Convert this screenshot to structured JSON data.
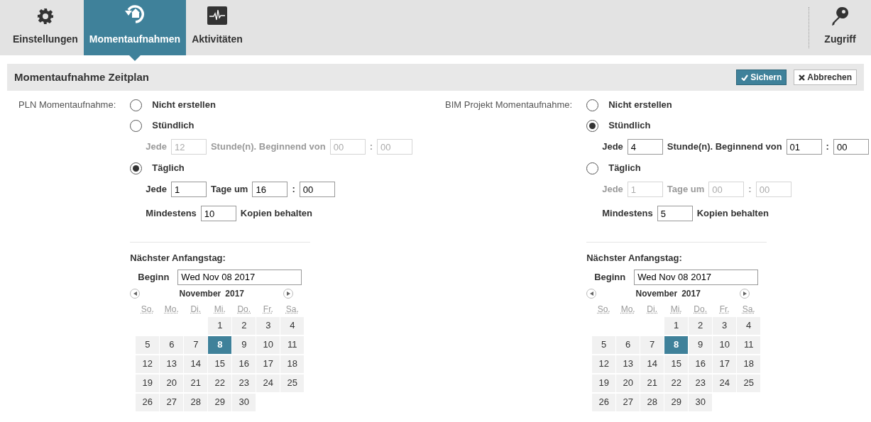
{
  "nav": {
    "tabs": [
      {
        "label": "Einstellungen",
        "selected": false
      },
      {
        "label": "Momentaufnahmen",
        "selected": true
      },
      {
        "label": "Aktivitäten",
        "selected": false
      }
    ],
    "right_tab": {
      "label": "Zugriff",
      "selected": false
    }
  },
  "section": {
    "title": "Momentaufnahme Zeitplan",
    "buttons": [
      {
        "label": "Sichern",
        "kind": "primary"
      },
      {
        "label": "Abbrechen",
        "kind": "secondary"
      }
    ]
  },
  "panels": [
    {
      "label": "PLN Momentaufnahme:",
      "options": [
        {
          "label": "Nicht erstellen",
          "selected": false
        },
        {
          "label": "Stündlich",
          "selected": false,
          "row": {
            "disabled": true,
            "parts": [
              {
                "kind": "text",
                "text": "Jede"
              },
              {
                "kind": "input",
                "value": "12"
              },
              {
                "kind": "text",
                "text": "Stunde(n). Beginnend von"
              },
              {
                "kind": "input",
                "value": "00"
              },
              {
                "kind": "text",
                "text": ":"
              },
              {
                "kind": "input",
                "value": "00"
              }
            ]
          }
        },
        {
          "label": "Täglich",
          "selected": true,
          "row": {
            "disabled": false,
            "parts": [
              {
                "kind": "text",
                "text": "Jede"
              },
              {
                "kind": "input",
                "value": "1"
              },
              {
                "kind": "text",
                "text": "Tage um"
              },
              {
                "kind": "input",
                "value": "16"
              },
              {
                "kind": "text",
                "text": ":"
              },
              {
                "kind": "input",
                "value": "00"
              }
            ]
          }
        }
      ],
      "keep": {
        "disabled": false,
        "parts": [
          {
            "kind": "text",
            "text": "Mindestens"
          },
          {
            "kind": "input",
            "value": "10"
          },
          {
            "kind": "text",
            "text": "Kopien behalten"
          }
        ]
      },
      "next_start": {
        "title": "Nächster Anfangstag:",
        "begin_label": "Beginn",
        "begin_value": "Wed Nov 08 2017",
        "month": "November",
        "year": "2017",
        "weekdays": [
          "So.",
          "Mo.",
          "Di.",
          "Mi.",
          "Do.",
          "Fr.",
          "Sa."
        ],
        "weeks": [
          [
            {
              "kind": "empty"
            },
            {
              "kind": "empty"
            },
            {
              "kind": "empty"
            },
            {
              "kind": "day",
              "day": "1",
              "selected": false
            },
            {
              "kind": "day",
              "day": "2",
              "selected": false
            },
            {
              "kind": "day",
              "day": "3",
              "selected": false
            },
            {
              "kind": "day",
              "day": "4",
              "selected": false
            }
          ],
          [
            {
              "kind": "day",
              "day": "5",
              "selected": false
            },
            {
              "kind": "day",
              "day": "6",
              "selected": false
            },
            {
              "kind": "day",
              "day": "7",
              "selected": false
            },
            {
              "kind": "day",
              "day": "8",
              "selected": true
            },
            {
              "kind": "day",
              "day": "9",
              "selected": false
            },
            {
              "kind": "day",
              "day": "10",
              "selected": false
            },
            {
              "kind": "day",
              "day": "11",
              "selected": false
            }
          ],
          [
            {
              "kind": "day",
              "day": "12",
              "selected": false
            },
            {
              "kind": "day",
              "day": "13",
              "selected": false
            },
            {
              "kind": "day",
              "day": "14",
              "selected": false
            },
            {
              "kind": "day",
              "day": "15",
              "selected": false
            },
            {
              "kind": "day",
              "day": "16",
              "selected": false
            },
            {
              "kind": "day",
              "day": "17",
              "selected": false
            },
            {
              "kind": "day",
              "day": "18",
              "selected": false
            }
          ],
          [
            {
              "kind": "day",
              "day": "19",
              "selected": false
            },
            {
              "kind": "day",
              "day": "20",
              "selected": false
            },
            {
              "kind": "day",
              "day": "21",
              "selected": false
            },
            {
              "kind": "day",
              "day": "22",
              "selected": false
            },
            {
              "kind": "day",
              "day": "23",
              "selected": false
            },
            {
              "kind": "day",
              "day": "24",
              "selected": false
            },
            {
              "kind": "day",
              "day": "25",
              "selected": false
            }
          ],
          [
            {
              "kind": "day",
              "day": "26",
              "selected": false
            },
            {
              "kind": "day",
              "day": "27",
              "selected": false
            },
            {
              "kind": "day",
              "day": "28",
              "selected": false
            },
            {
              "kind": "day",
              "day": "29",
              "selected": false
            },
            {
              "kind": "day",
              "day": "30",
              "selected": false
            },
            {
              "kind": "empty"
            },
            {
              "kind": "empty"
            }
          ]
        ]
      }
    },
    {
      "label": "BIM Projekt Momentaufnahme:",
      "options": [
        {
          "label": "Nicht erstellen",
          "selected": false
        },
        {
          "label": "Stündlich",
          "selected": true,
          "row": {
            "disabled": false,
            "parts": [
              {
                "kind": "text",
                "text": "Jede"
              },
              {
                "kind": "input",
                "value": "4"
              },
              {
                "kind": "text",
                "text": "Stunde(n). Beginnend von"
              },
              {
                "kind": "input",
                "value": "01"
              },
              {
                "kind": "text",
                "text": ":"
              },
              {
                "kind": "input",
                "value": "00"
              }
            ]
          }
        },
        {
          "label": "Täglich",
          "selected": false,
          "row": {
            "disabled": true,
            "parts": [
              {
                "kind": "text",
                "text": "Jede"
              },
              {
                "kind": "input",
                "value": "1"
              },
              {
                "kind": "text",
                "text": "Tage um"
              },
              {
                "kind": "input",
                "value": "00"
              },
              {
                "kind": "text",
                "text": ":"
              },
              {
                "kind": "input",
                "value": "00"
              }
            ]
          }
        }
      ],
      "keep": {
        "disabled": false,
        "parts": [
          {
            "kind": "text",
            "text": "Mindestens"
          },
          {
            "kind": "input",
            "value": "5"
          },
          {
            "kind": "text",
            "text": "Kopien behalten"
          }
        ]
      },
      "next_start": {
        "title": "Nächster Anfangstag:",
        "begin_label": "Beginn",
        "begin_value": "Wed Nov 08 2017",
        "month": "November",
        "year": "2017",
        "weekdays": [
          "So.",
          "Mo.",
          "Di.",
          "Mi.",
          "Do.",
          "Fr.",
          "Sa."
        ],
        "weeks": [
          [
            {
              "kind": "empty"
            },
            {
              "kind": "empty"
            },
            {
              "kind": "empty"
            },
            {
              "kind": "day",
              "day": "1",
              "selected": false
            },
            {
              "kind": "day",
              "day": "2",
              "selected": false
            },
            {
              "kind": "day",
              "day": "3",
              "selected": false
            },
            {
              "kind": "day",
              "day": "4",
              "selected": false
            }
          ],
          [
            {
              "kind": "day",
              "day": "5",
              "selected": false
            },
            {
              "kind": "day",
              "day": "6",
              "selected": false
            },
            {
              "kind": "day",
              "day": "7",
              "selected": false
            },
            {
              "kind": "day",
              "day": "8",
              "selected": true
            },
            {
              "kind": "day",
              "day": "9",
              "selected": false
            },
            {
              "kind": "day",
              "day": "10",
              "selected": false
            },
            {
              "kind": "day",
              "day": "11",
              "selected": false
            }
          ],
          [
            {
              "kind": "day",
              "day": "12",
              "selected": false
            },
            {
              "kind": "day",
              "day": "13",
              "selected": false
            },
            {
              "kind": "day",
              "day": "14",
              "selected": false
            },
            {
              "kind": "day",
              "day": "15",
              "selected": false
            },
            {
              "kind": "day",
              "day": "16",
              "selected": false
            },
            {
              "kind": "day",
              "day": "17",
              "selected": false
            },
            {
              "kind": "day",
              "day": "18",
              "selected": false
            }
          ],
          [
            {
              "kind": "day",
              "day": "19",
              "selected": false
            },
            {
              "kind": "day",
              "day": "20",
              "selected": false
            },
            {
              "kind": "day",
              "day": "21",
              "selected": false
            },
            {
              "kind": "day",
              "day": "22",
              "selected": false
            },
            {
              "kind": "day",
              "day": "23",
              "selected": false
            },
            {
              "kind": "day",
              "day": "24",
              "selected": false
            },
            {
              "kind": "day",
              "day": "25",
              "selected": false
            }
          ],
          [
            {
              "kind": "day",
              "day": "26",
              "selected": false
            },
            {
              "kind": "day",
              "day": "27",
              "selected": false
            },
            {
              "kind": "day",
              "day": "28",
              "selected": false
            },
            {
              "kind": "day",
              "day": "29",
              "selected": false
            },
            {
              "kind": "day",
              "day": "30",
              "selected": false
            },
            {
              "kind": "empty"
            },
            {
              "kind": "empty"
            }
          ]
        ]
      }
    }
  ]
}
